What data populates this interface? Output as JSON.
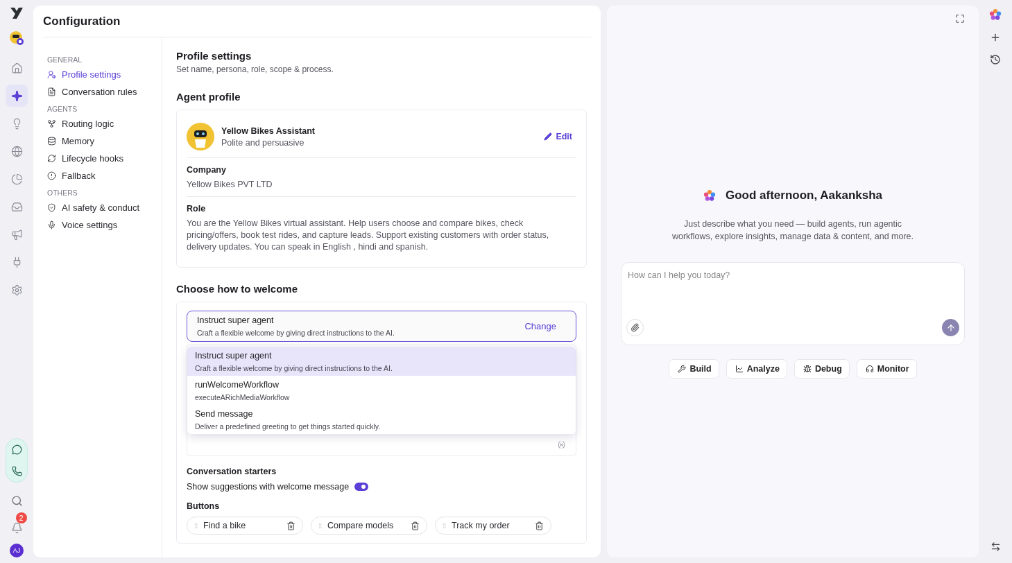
{
  "rail": {
    "top": [
      {
        "selected": false
      },
      {
        "selected": true
      },
      {
        "selected": false
      },
      {
        "selected": false
      },
      {
        "selected": false
      },
      {
        "selected": false
      },
      {
        "selected": false
      },
      {
        "selected": false
      },
      {
        "selected": false
      }
    ],
    "notifications": "2",
    "avatar": "AJ"
  },
  "config": {
    "title": "Configuration",
    "nav": [
      {
        "heading": "GENERAL",
        "items": [
          {
            "label": "Profile settings",
            "selected": true
          },
          {
            "label": "Conversation rules",
            "selected": false
          }
        ]
      },
      {
        "heading": "AGENTS",
        "items": [
          {
            "label": "Routing logic",
            "selected": false
          },
          {
            "label": "Memory",
            "selected": false
          },
          {
            "label": "Lifecycle hooks",
            "selected": false
          },
          {
            "label": "Fallback",
            "selected": false
          }
        ]
      },
      {
        "heading": "OTHERS",
        "items": [
          {
            "label": "AI safety & conduct",
            "selected": false
          },
          {
            "label": "Voice settings",
            "selected": false
          }
        ]
      }
    ]
  },
  "profile_settings": {
    "title": "Profile settings",
    "subtitle": "Set name, persona, role, scope & process."
  },
  "agent_profile": {
    "heading": "Agent profile",
    "name": "Yellow Bikes Assistant",
    "persona": "Polite and persuasive",
    "edit": "Edit",
    "fields": [
      {
        "label": "Company",
        "value": "Yellow Bikes PVT LTD"
      },
      {
        "label": "Role",
        "value": "You are the Yellow Bikes virtual assistant. Help users choose and compare bikes, check pricing/offers, book test rides, and capture leads. Support existing customers with order status, delivery updates. You can speak in English , hindi and spanish."
      }
    ]
  },
  "welcome": {
    "heading": "Choose how to welcome",
    "current": {
      "title": "Instruct super agent",
      "description": "Craft a flexible welcome by giving direct instructions to the AI.",
      "action": "Change"
    },
    "options": [
      {
        "title": "Instruct super agent",
        "description": "Craft a flexible welcome by giving direct instructions to the AI.",
        "selected": true
      },
      {
        "title": "runWelcomeWorkflow",
        "description": "executeARichMediaWorkflow",
        "selected": false
      },
      {
        "title": "Send message",
        "description": "Deliver a predefined greeting to get things started quickly.",
        "selected": false
      }
    ],
    "starters_heading": "Conversation starters",
    "suggestions_label": "Show suggestions with welcome message",
    "suggestions_on": true,
    "buttons_heading": "Buttons",
    "buttons": [
      "Find a bike",
      "Compare models",
      "Track my order"
    ]
  },
  "assistant": {
    "greeting": "Good afternoon, Aakanksha",
    "intro": "Just describe what you need — build agents, run agentic workflows, explore insights, manage data & content, and more.",
    "placeholder": "How can I help you today?",
    "actions": [
      "Build",
      "Analyze",
      "Debug",
      "Monitor"
    ]
  }
}
